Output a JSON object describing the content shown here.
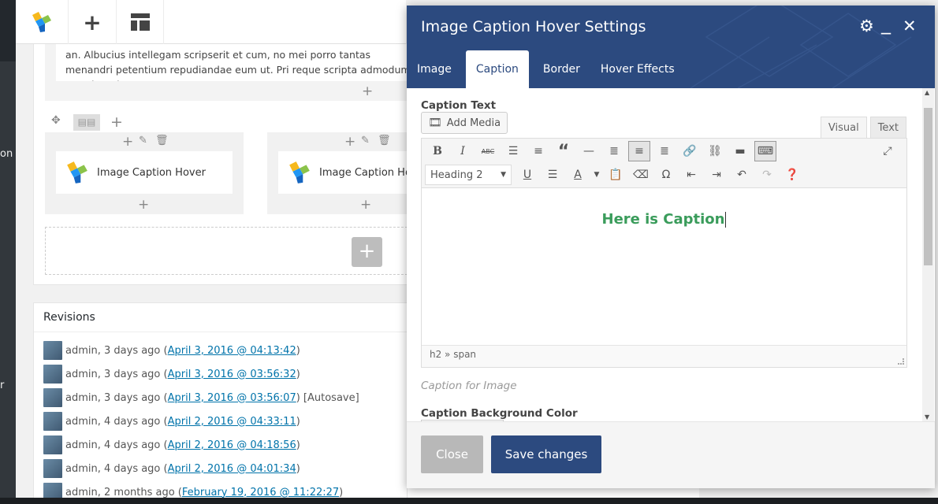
{
  "admin_menu": {
    "fragment_1": "on",
    "fragment_2": "r"
  },
  "editor_text": "an. Albucius intellegam scripserit et cum, no mei porro tantas menandri petentium repudiandae eum ut. Pri reque scripta admodum te, rebum l",
  "elements": [
    {
      "label": "Image Caption Hover"
    },
    {
      "label": "Image Caption Ho"
    }
  ],
  "revisions": {
    "title": "Revisions",
    "items": [
      {
        "who": "admin, 3 days ago (",
        "link": "April 3, 2016 @ 04:13:42",
        "suffix": ")"
      },
      {
        "who": "admin, 3 days ago (",
        "link": "April 3, 2016 @ 03:56:32",
        "suffix": ")"
      },
      {
        "who": "admin, 3 days ago (",
        "link": "April 3, 2016 @ 03:56:07",
        "suffix": ") [Autosave]"
      },
      {
        "who": "admin, 4 days ago (",
        "link": "April 2, 2016 @ 04:33:11",
        "suffix": ")"
      },
      {
        "who": "admin, 4 days ago (",
        "link": "April 2, 2016 @ 04:18:56",
        "suffix": ")"
      },
      {
        "who": "admin, 4 days ago (",
        "link": "April 2, 2016 @ 04:01:34",
        "suffix": ")"
      },
      {
        "who": "admin, 2 months ago (",
        "link": "February 19, 2016 @ 11:22:27",
        "suffix": ")"
      }
    ]
  },
  "modal": {
    "title": "Image Caption Hover Settings",
    "tabs": [
      {
        "label": "Image"
      },
      {
        "label": "Caption",
        "active": true
      },
      {
        "label": "Border"
      },
      {
        "label": "Hover Effects"
      }
    ],
    "field_caption_text": "Caption Text",
    "add_media": "Add Media",
    "editor_tabs": {
      "visual": "Visual",
      "text": "Text"
    },
    "format_select": "Heading 2",
    "content_heading": "Here is Caption",
    "status_path": "h2 » span",
    "field_description": "Caption for Image",
    "field_bg_color": "Caption Background Color",
    "close_label": "Close",
    "save_label": "Save changes"
  },
  "colors": {
    "header": "#2c4a7f",
    "caption_text": "#3a9c5b",
    "link": "#0073aa",
    "close_button": "#b8b8b8"
  }
}
